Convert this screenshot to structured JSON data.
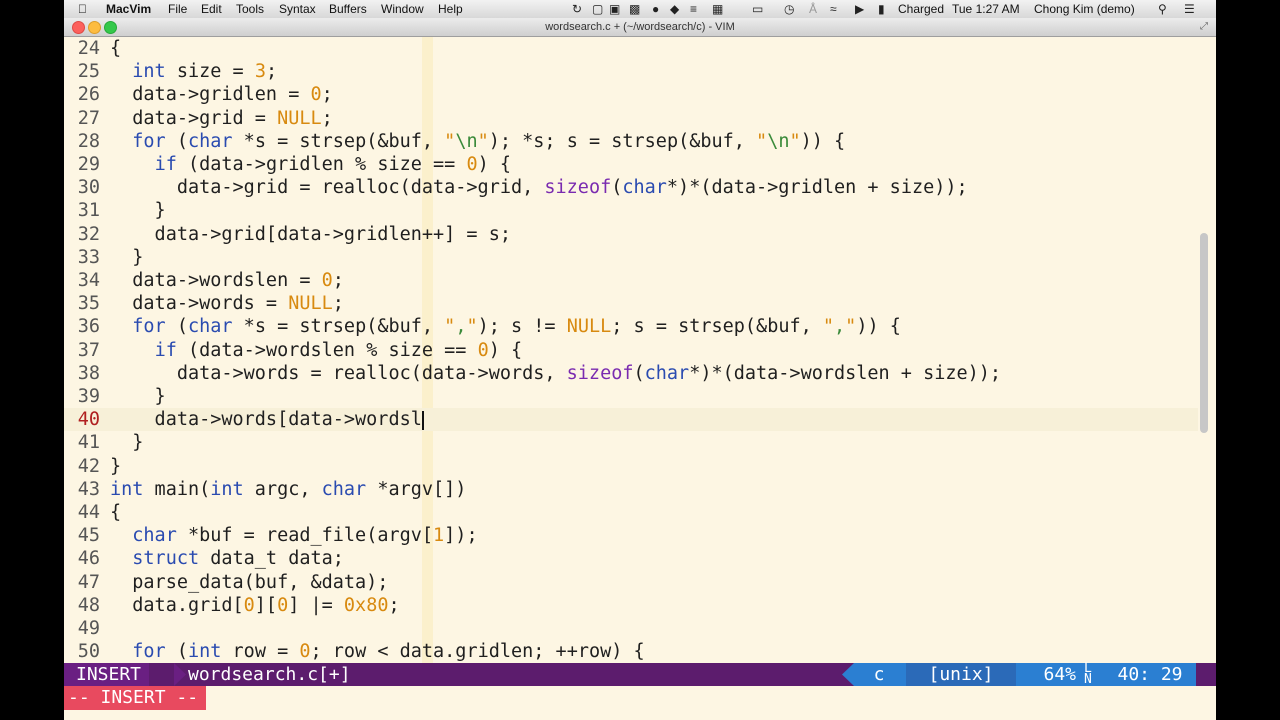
{
  "menubar": {
    "app": "MacVim",
    "items": [
      "File",
      "Edit",
      "Tools",
      "Syntax",
      "Buffers",
      "Window",
      "Help"
    ],
    "battery": "Charged",
    "clock": "Tue 1:27 AM",
    "user": "Chong Kim (demo)"
  },
  "window": {
    "title": "wordsearch.c + (~/wordsearch/c) - VIM"
  },
  "editor": {
    "current_line": 40,
    "lines": [
      {
        "n": "24",
        "code": "{"
      },
      {
        "n": "25",
        "code": "  int size = 3;"
      },
      {
        "n": "26",
        "code": "  data->gridlen = 0;"
      },
      {
        "n": "27",
        "code": "  data->grid = NULL;"
      },
      {
        "n": "28",
        "code": "  for (char *s = strsep(&buf, \"\\n\"); *s; s = strsep(&buf, \"\\n\")) {"
      },
      {
        "n": "29",
        "code": "    if (data->gridlen % size == 0) {"
      },
      {
        "n": "30",
        "code": "      data->grid = realloc(data->grid, sizeof(char*)*(data->gridlen + size));"
      },
      {
        "n": "31",
        "code": "    }"
      },
      {
        "n": "32",
        "code": "    data->grid[data->gridlen++] = s;"
      },
      {
        "n": "33",
        "code": "  }"
      },
      {
        "n": "34",
        "code": "  data->wordslen = 0;"
      },
      {
        "n": "35",
        "code": "  data->words = NULL;"
      },
      {
        "n": "36",
        "code": "  for (char *s = strsep(&buf, \",\"); s != NULL; s = strsep(&buf, \",\")) {"
      },
      {
        "n": "37",
        "code": "    if (data->wordslen % size == 0) {"
      },
      {
        "n": "38",
        "code": "      data->words = realloc(data->words, sizeof(char*)*(data->wordslen + size));"
      },
      {
        "n": "39",
        "code": "    }"
      },
      {
        "n": "40",
        "code": "    data->words[data->wordsl"
      },
      {
        "n": "41",
        "code": "  }"
      },
      {
        "n": "42",
        "code": "}"
      },
      {
        "n": "43",
        "code": "int main(int argc, char *argv[])"
      },
      {
        "n": "44",
        "code": "{"
      },
      {
        "n": "45",
        "code": "  char *buf = read_file(argv[1]);"
      },
      {
        "n": "46",
        "code": "  struct data_t data;"
      },
      {
        "n": "47",
        "code": "  parse_data(buf, &data);"
      },
      {
        "n": "48",
        "code": "  data.grid[0][0] |= 0x80;"
      },
      {
        "n": "49",
        "code": ""
      },
      {
        "n": "50",
        "code": "  for (int row = 0; row < data.gridlen; ++row) {"
      }
    ]
  },
  "statusline": {
    "mode": "INSERT",
    "filename": "wordsearch.c[+]",
    "filetype": "c",
    "format": "[unix]",
    "percent": "64%",
    "ln_icon": "LN",
    "position": "40: 29"
  },
  "cmdline": {
    "mode": "-- INSERT --"
  },
  "colors": {
    "statusline_bg": "#5c1c6d",
    "mode_bg": "#6a1f82",
    "right_bg": "#2b7fd2",
    "cmd_mode_bg": "#e84a5f",
    "editor_bg": "#fdf6e3"
  }
}
